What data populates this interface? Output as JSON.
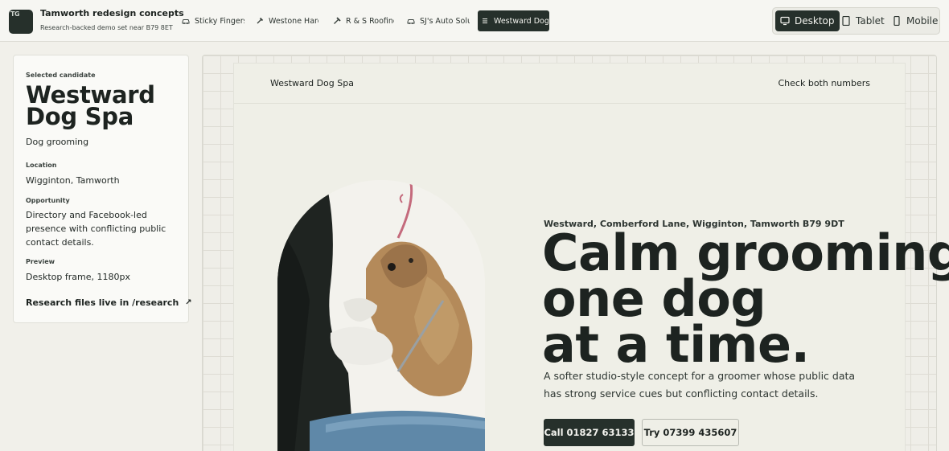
{
  "brand": {
    "logo_text": "TG",
    "title": "Tamworth redesign concepts",
    "subtitle": "Research-backed demo set near B79 8ET"
  },
  "tabs": [
    {
      "label": "Sticky Fingers",
      "icon": "car-icon",
      "active": false
    },
    {
      "label": "Westone Hardware",
      "icon": "hammer-icon",
      "active": false
    },
    {
      "label": "R & S Roofing",
      "icon": "hammer-icon",
      "active": false
    },
    {
      "label": "SJ's Auto Solutions",
      "icon": "car-icon",
      "active": false
    },
    {
      "label": "Westward Dog Spa",
      "icon": "menu-icon",
      "active": true
    }
  ],
  "devices": [
    {
      "label": "Desktop",
      "icon": "monitor-icon",
      "active": true
    },
    {
      "label": "Tablet",
      "icon": "tablet-icon",
      "active": false
    },
    {
      "label": "Mobile",
      "icon": "phone-icon",
      "active": false
    }
  ],
  "panel": {
    "selected_label": "Selected candidate",
    "name": "Westward Dog Spa",
    "category": "Dog grooming",
    "location_label": "Location",
    "location": "Wigginton, Tamworth",
    "opportunity_label": "Opportunity",
    "opportunity": "Directory and Facebook-led presence with conflicting public contact details.",
    "preview_label": "Preview",
    "preview": "Desktop frame, 1180px",
    "research_link": "Research files live in /research",
    "research_icon": "arrow-up-right-icon"
  },
  "site": {
    "name": "Westward Dog Spa",
    "header_link": "Check both numbers",
    "eyebrow": "Westward, Comberford Lane, Wigginton, Tamworth B79 9DT",
    "headline": [
      "Calm grooming,",
      "one dog",
      "at a time."
    ],
    "lede": "A softer studio-style concept for a groomer whose public data has strong service cues but conflicting contact details.",
    "cta_primary": "Call 01827 63133",
    "cta_secondary": "Try 07399 435607"
  },
  "colors": {
    "dark": "#26302b",
    "background": "#f1f0ea",
    "frame": "#efefe7"
  }
}
